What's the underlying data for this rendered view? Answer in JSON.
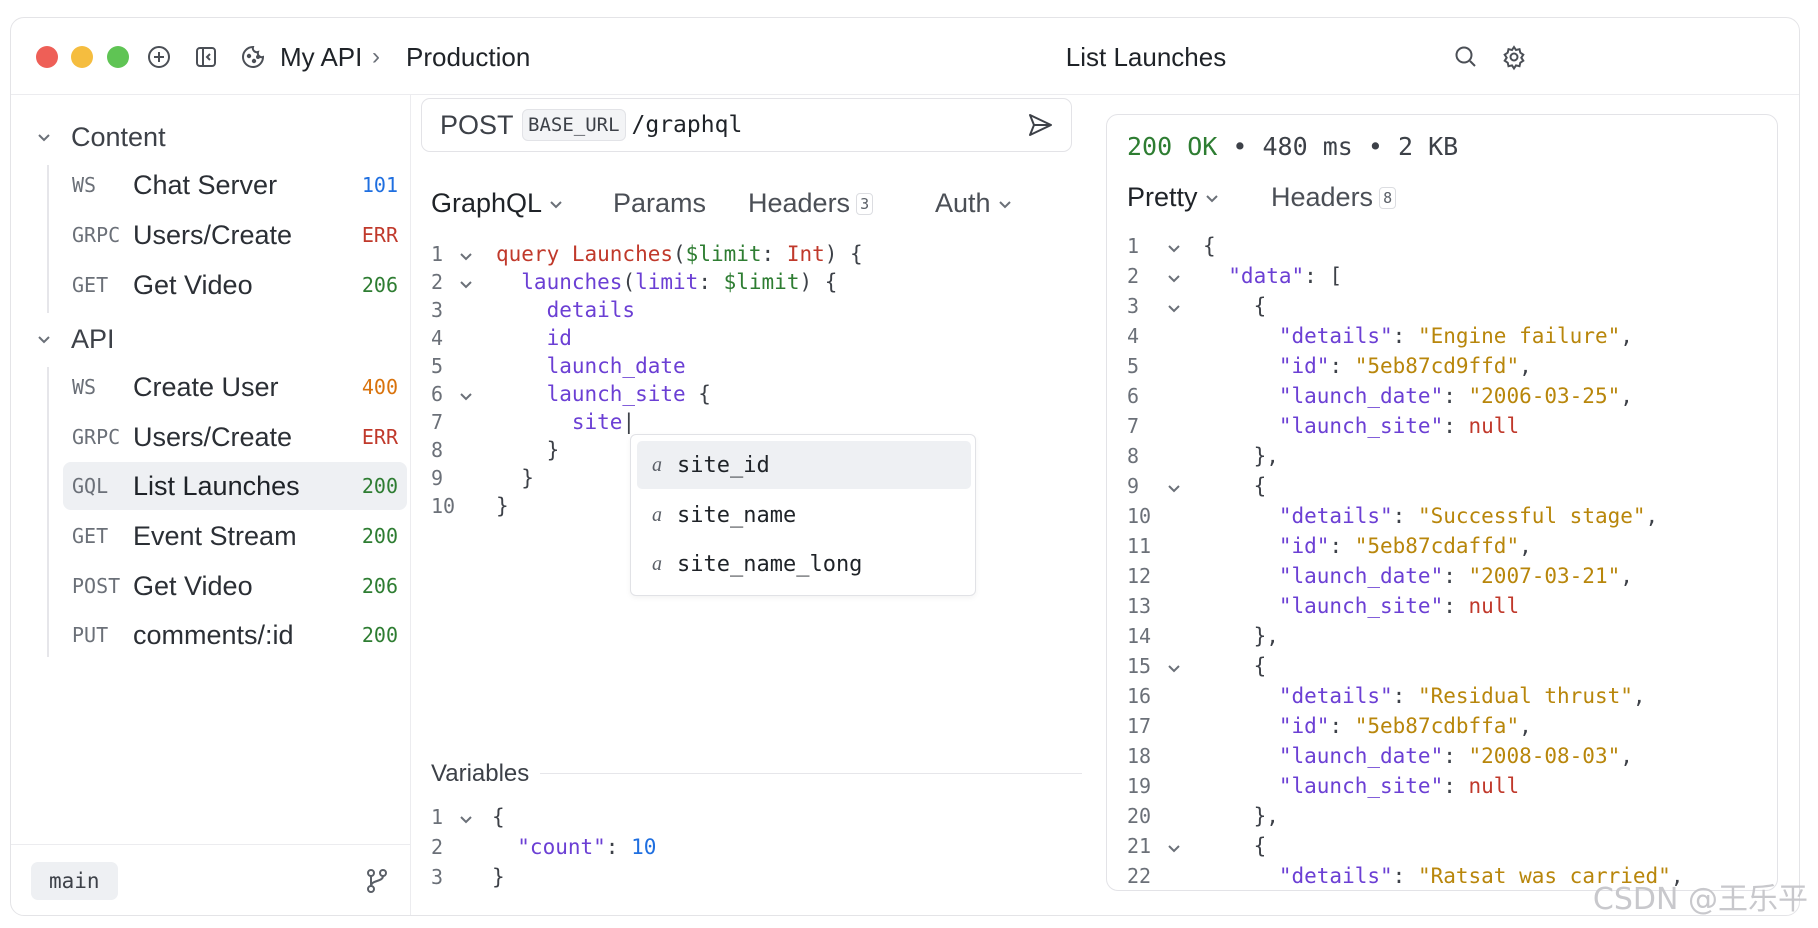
{
  "window": {
    "breadcrumb": {
      "workspace": "My API",
      "separator": "›",
      "environment": "Production"
    },
    "title": "List Launches"
  },
  "sidebar": {
    "groups": [
      {
        "label": "Content",
        "items": [
          {
            "method": "WS",
            "name": "Chat Server",
            "status": "101",
            "status_color": "#1f6fe0"
          },
          {
            "method": "GRPC",
            "name": "Users/Create",
            "status": "ERR",
            "status_color": "#c0392b"
          },
          {
            "method": "GET",
            "name": "Get Video",
            "status": "206",
            "status_color": "#2e7d32"
          }
        ]
      },
      {
        "label": "API",
        "items": [
          {
            "method": "WS",
            "name": "Create User",
            "status": "400",
            "status_color": "#d9730d"
          },
          {
            "method": "GRPC",
            "name": "Users/Create",
            "status": "ERR",
            "status_color": "#c0392b"
          },
          {
            "method": "GQL",
            "name": "List Launches",
            "status": "200",
            "status_color": "#2e7d32",
            "active": true
          },
          {
            "method": "GET",
            "name": "Event Stream",
            "status": "200",
            "status_color": "#2e7d32"
          },
          {
            "method": "POST",
            "name": "Get Video",
            "status": "206",
            "status_color": "#2e7d32"
          },
          {
            "method": "PUT",
            "name": "comments/:id",
            "status": "200",
            "status_color": "#2e7d32"
          }
        ]
      }
    ],
    "branch": "main"
  },
  "request": {
    "method": "POST",
    "url_variable": "BASE_URL",
    "path": "/graphql",
    "tabs": [
      {
        "label": "GraphQL",
        "dropdown": true,
        "active": true
      },
      {
        "label": "Params"
      },
      {
        "label": "Headers",
        "count": "3"
      },
      {
        "label": "Auth",
        "dropdown": true
      }
    ],
    "query_lines": [
      "query Launches($limit: Int) {",
      "  launches(limit: $limit) {",
      "    details",
      "    id",
      "    launch_date",
      "    launch_site {",
      "      site",
      "    }",
      "  }",
      "}"
    ],
    "autocomplete": [
      {
        "icon": "a",
        "label": "site_id",
        "selected": true
      },
      {
        "icon": "a",
        "label": "site_name"
      },
      {
        "icon": "a",
        "label": "site_name_long"
      }
    ],
    "variables_label": "Variables",
    "variables_lines": [
      "{",
      "  \"count\": 10",
      "}"
    ]
  },
  "response": {
    "status_code": "200 OK",
    "time": "480 ms",
    "size": "2 KB",
    "separator": "•",
    "tabs": [
      {
        "label": "Pretty",
        "dropdown": true,
        "active": true
      },
      {
        "label": "Headers",
        "count": "8"
      }
    ],
    "body_lines": [
      "{",
      "  \"data\": [",
      "    {",
      "      \"details\": \"Engine failure\",",
      "      \"id\": \"5eb87cd9ffd\",",
      "      \"launch_date\": \"2006-03-25\",",
      "      \"launch_site\": null",
      "    },",
      "    {",
      "      \"details\": \"Successful stage\",",
      "      \"id\": \"5eb87cdaffd\",",
      "      \"launch_date\": \"2007-03-21\",",
      "      \"launch_site\": null",
      "    },",
      "    {",
      "      \"details\": \"Residual thrust\",",
      "      \"id\": \"5eb87cdbffa\",",
      "      \"launch_date\": \"2008-08-03\",",
      "      \"launch_site\": null",
      "    },",
      "    {",
      "      \"details\": \"Ratsat was carried\","
    ]
  },
  "watermark": "CSDN @王乐平"
}
